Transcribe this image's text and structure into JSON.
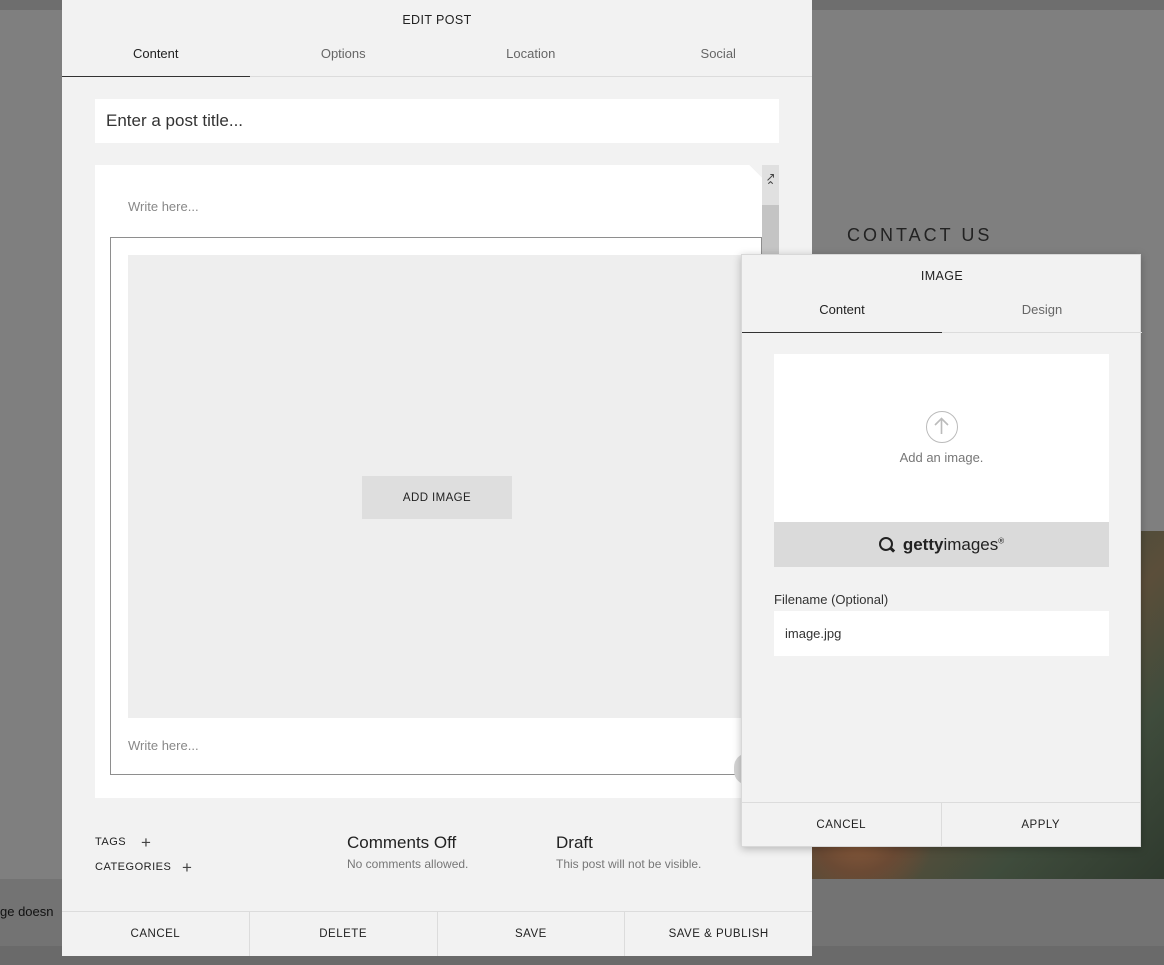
{
  "background": {
    "contact_heading": "CONTACT US",
    "footer_fragment": "ge doesn"
  },
  "edit_post": {
    "title": "EDIT POST",
    "tabs": [
      {
        "label": "Content",
        "active": true
      },
      {
        "label": "Options",
        "active": false
      },
      {
        "label": "Location",
        "active": false
      },
      {
        "label": "Social",
        "active": false
      }
    ],
    "title_placeholder": "Enter a post title...",
    "editor": {
      "write_here_top": "Write here...",
      "add_image_label": "ADD IMAGE",
      "write_here_bottom": "Write here..."
    },
    "meta": {
      "tags_label": "TAGS",
      "categories_label": "CATEGORIES",
      "comments_heading": "Comments Off",
      "comments_sub": "No comments allowed.",
      "status_heading": "Draft",
      "status_sub": "This post will not be visible."
    },
    "footer": {
      "cancel": "CANCEL",
      "delete": "DELETE",
      "save": "SAVE",
      "save_publish": "SAVE & PUBLISH"
    }
  },
  "image_panel": {
    "title": "IMAGE",
    "tabs": [
      {
        "label": "Content",
        "active": true
      },
      {
        "label": "Design",
        "active": false
      }
    ],
    "upload_text": "Add an image.",
    "getty": {
      "bold": "getty",
      "rest": "images",
      "mark": "®"
    },
    "filename_label": "Filename (Optional)",
    "filename_value": "image.jpg",
    "cancel": "CANCEL",
    "apply": "APPLY"
  },
  "icons": [
    "expand-icon",
    "chevron-up-icon",
    "plus-icon",
    "upload-arrow-icon",
    "search-icon"
  ]
}
